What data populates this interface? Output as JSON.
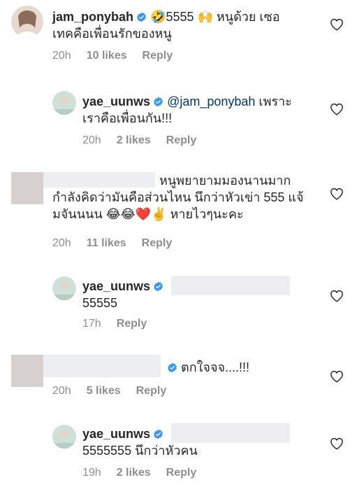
{
  "comments": [
    {
      "username": "jam_ponybah",
      "line1": "🤣5555 🙌 หนูด้วย เซอ",
      "line2": "เทคคือเพื่อนรักของหนู",
      "time": "20h",
      "likes": "10 likes",
      "reply": "Reply"
    },
    {
      "username": "yae_uunws",
      "mention": "@jam_ponybah",
      "line1_rest": " เพราะ",
      "line2": "เราคือเพื่อนกัน!!!",
      "time": "20h",
      "likes": "2 likes",
      "reply": "Reply"
    },
    {
      "line1": "หนูพยายามมองนานมาก",
      "line2": "กำลังคิดว่ามันคือส่วนไหน นึกว่าหัวเข่า 555 แจ้",
      "line3": "มจันนนน 😂😂❤️✌️ หายไวๆนะคะ",
      "time": "20h",
      "likes": "11 likes",
      "reply": "Reply"
    },
    {
      "username": "yae_uunws",
      "line2": "55555",
      "time": "17h",
      "reply": "Reply"
    },
    {
      "line1": "ตกใจจจ....!!!",
      "time": "20h",
      "likes": "5 likes",
      "reply": "Reply"
    },
    {
      "username": "yae_uunws",
      "line2": "5555555 นึกว่าหัวคน",
      "time": "19h",
      "likes": "2 likes",
      "reply": "Reply"
    }
  ],
  "colors": {
    "verified": "#3897f0",
    "meta": "#8e8e8e",
    "mention": "#00376b"
  },
  "icons": [
    "verified-badge-icon",
    "heart-icon"
  ]
}
